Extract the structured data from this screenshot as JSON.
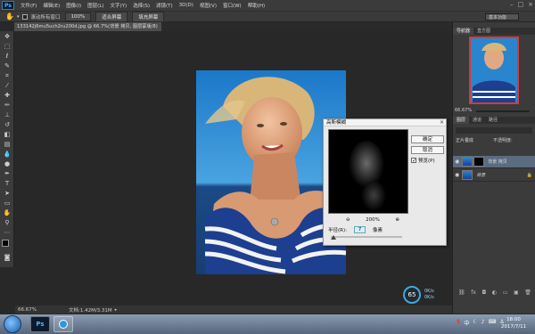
{
  "menubar": {
    "logo": "Ps",
    "items": [
      "文件(F)",
      "编辑(E)",
      "图像(I)",
      "图层(L)",
      "文字(Y)",
      "选择(S)",
      "滤镜(T)",
      "3D(D)",
      "视图(V)",
      "窗口(W)",
      "帮助(H)"
    ]
  },
  "options": {
    "scroll_all_label": "滚动所有窗口",
    "btn1": "100%",
    "btn2": "适合屏幕",
    "btn3": "填充屏幕",
    "workspace": "基本功能"
  },
  "tab": {
    "title": "133142j6mu5uch2ru200d.jpg @ 66.7%(背景 拷贝, 图层蒙版/8)"
  },
  "status": {
    "zoom": "66.67%",
    "doc_info": "文档:1.42M/3.31M"
  },
  "panels": {
    "top_tabs": [
      "导航器",
      "直方图"
    ],
    "nav_zoom": "66.67%",
    "layer_tabs": [
      "图层",
      "通道",
      "路径"
    ],
    "blend_mode": "正片叠底",
    "opacity_label": "不透明度:",
    "layers": [
      {
        "name": "背景 拷贝"
      },
      {
        "name": "背景"
      }
    ]
  },
  "dialog": {
    "title": "高斯模糊",
    "ok": "确定",
    "cancel": "取消",
    "preview_label": "预览(P)",
    "zoom_level": "200%",
    "radius_label": "半径(R):",
    "radius_value": "7",
    "unit": "像素"
  },
  "netmeter": {
    "percent": "65",
    "up": "0K/s",
    "down": "0K/s"
  },
  "taskbar": {
    "ps_label": "Ps",
    "time": "18:00",
    "date": "2017/7/11"
  }
}
